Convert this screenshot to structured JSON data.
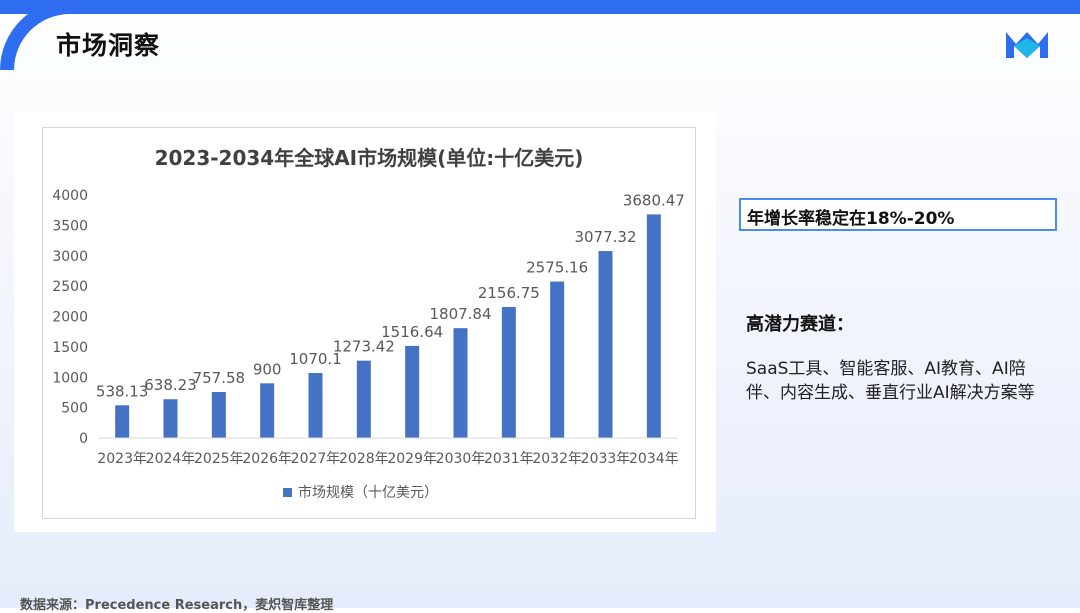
{
  "page": {
    "title": "市场洞察"
  },
  "chart_data": {
    "type": "bar",
    "title": "2023-2034年全球AI市场规模(单位:十亿美元)",
    "categories": [
      "2023年",
      "2024年",
      "2025年",
      "2026年",
      "2027年",
      "2028年",
      "2029年",
      "2030年",
      "2031年",
      "2032年",
      "2033年",
      "2034年"
    ],
    "series": [
      {
        "name": "市场规模（十亿美元）",
        "values": [
          538.13,
          638.23,
          757.58,
          900,
          1070.1,
          1273.42,
          1516.64,
          1807.84,
          2156.75,
          2575.16,
          3077.32,
          3680.47
        ],
        "labels": [
          "538.13",
          "638.23",
          "757.58",
          "900",
          "1070.1",
          "1273.42",
          "1516.64",
          "1807.84",
          "2156.75",
          "2575.16",
          "3077.32",
          "3680.47"
        ]
      }
    ],
    "ylim": [
      0,
      4000
    ],
    "yticks": [
      0,
      500,
      1000,
      1500,
      2000,
      2500,
      3000,
      3500,
      4000
    ],
    "grid": false,
    "legend_position": "bottom",
    "bar_color": "#4472c4"
  },
  "insights": {
    "highlight": "年增长率稳定在18%-20%",
    "tracks_heading": "高潜力赛道：",
    "tracks_text": "SaaS工具、智能客服、AI教育、AI陪伴、内容生成、垂直行业AI解决方案等"
  },
  "source": "数据来源：Precedence Research，麦炽智库整理",
  "colors": {
    "accent": "#2f6df0",
    "highlight_border": "#4a8ce8"
  }
}
